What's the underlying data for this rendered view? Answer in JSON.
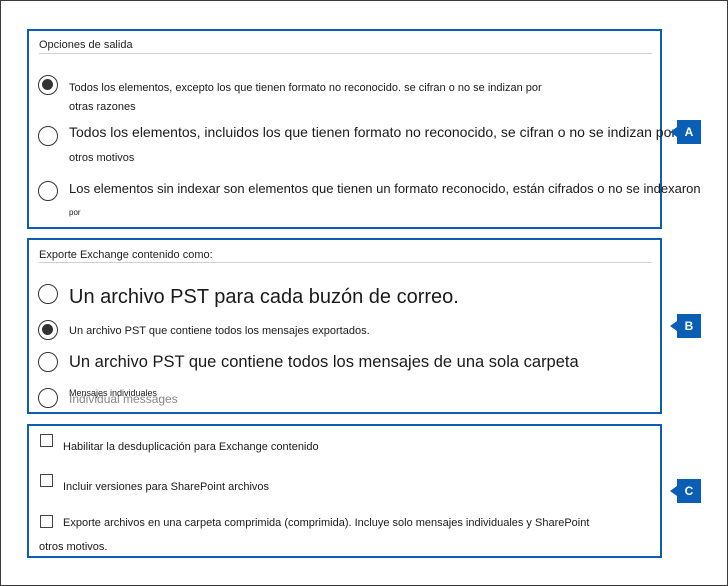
{
  "output_options": {
    "title": "Opciones de salida",
    "options": [
      {
        "line1": "Todos los elementos, excepto los que tienen formato no reconocido. se cifran o no se indizan por",
        "line2": "otras razones",
        "selected": true
      },
      {
        "line1": "Todos los elementos, incluidos los que tienen formato no reconocido, se cifran o no se indizan por",
        "line2": "otros motivos",
        "selected": false
      },
      {
        "line1": "Los elementos sin indexar son elementos que tienen un formato reconocido, están cifrados o no se indexaron",
        "line2": "por",
        "selected": false
      }
    ]
  },
  "exchange_export": {
    "title": "Exporte Exchange contenido como:",
    "options": [
      {
        "label": "Un archivo PST para cada buzón de correo.",
        "selected": false
      },
      {
        "label": "Un archivo PST que contiene todos los mensajes exportados.",
        "selected": true
      },
      {
        "label": "Un archivo PST que contiene todos los mensajes de una sola carpeta",
        "selected": false
      },
      {
        "label": "Mensajes individuales",
        "ghost": "Individual messages",
        "selected": false
      }
    ]
  },
  "extra_options": {
    "items": [
      {
        "label": "Habilitar la desduplicación para Exchange contenido",
        "checked": false
      },
      {
        "label": "Incluir versiones para SharePoint archivos",
        "checked": false
      },
      {
        "line1": "Exporte archivos en una carpeta comprimida (comprimida). Incluye solo mensajes individuales y SharePoint",
        "line2": "otros motivos.",
        "checked": false
      }
    ]
  },
  "callouts": {
    "a": "A",
    "b": "B",
    "c": "C"
  },
  "colors": {
    "accent": "#0a5fb4",
    "border": "#3a3a3a"
  }
}
